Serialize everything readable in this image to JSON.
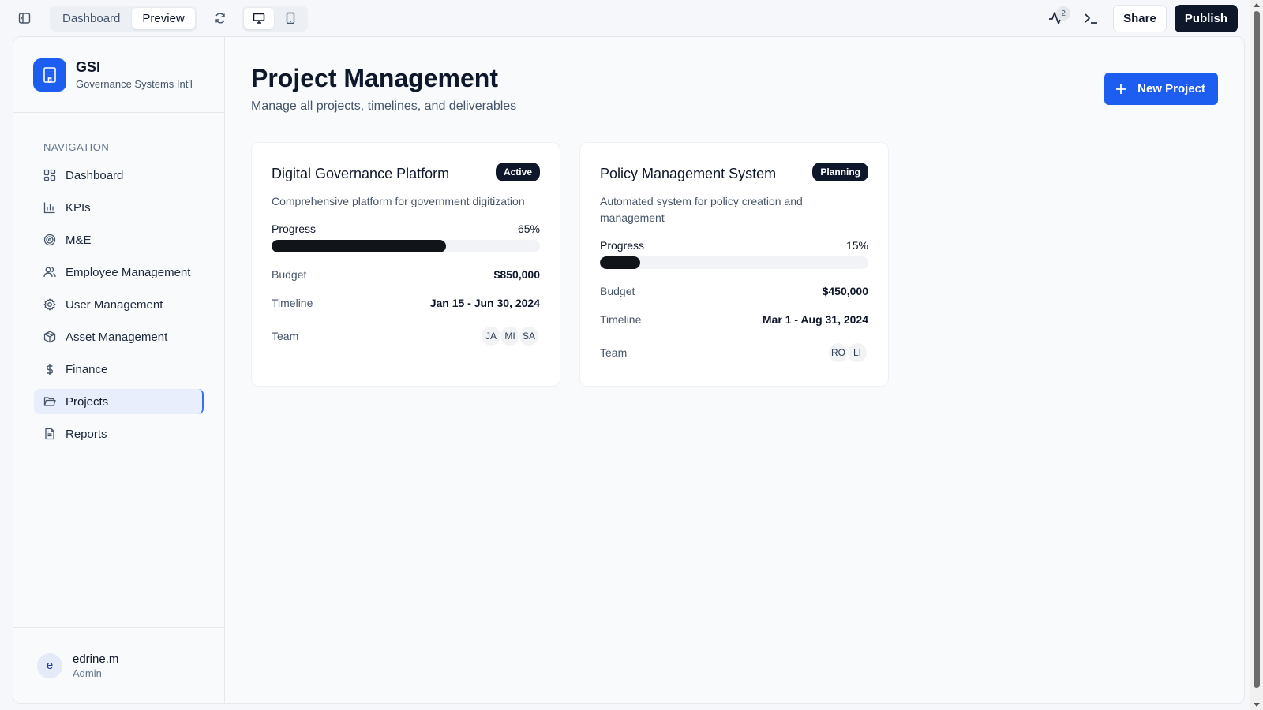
{
  "topbar": {
    "tabs": [
      {
        "label": "Dashboard",
        "active": false
      },
      {
        "label": "Preview",
        "active": true
      }
    ],
    "activity_count": "2",
    "share_label": "Share",
    "publish_label": "Publish"
  },
  "brand": {
    "name": "GSI",
    "subtitle": "Governance Systems Int'l",
    "color": "#1d5ef0"
  },
  "sidebar": {
    "heading": "NAVIGATION",
    "items": [
      {
        "label": "Dashboard",
        "icon": "grid-icon",
        "active": false
      },
      {
        "label": "KPIs",
        "icon": "bar-chart-icon",
        "active": false
      },
      {
        "label": "M&E",
        "icon": "target-icon",
        "active": false
      },
      {
        "label": "Employee Management",
        "icon": "users-icon",
        "active": false
      },
      {
        "label": "User Management",
        "icon": "gear-icon",
        "active": false
      },
      {
        "label": "Asset Management",
        "icon": "package-icon",
        "active": false
      },
      {
        "label": "Finance",
        "icon": "dollar-icon",
        "active": false
      },
      {
        "label": "Projects",
        "icon": "folder-icon",
        "active": true
      },
      {
        "label": "Reports",
        "icon": "file-icon",
        "active": false
      }
    ]
  },
  "user": {
    "initial": "e",
    "name": "edrine.m",
    "role": "Admin"
  },
  "main": {
    "title": "Project Management",
    "subtitle": "Manage all projects, timelines, and deliverables",
    "new_project_label": "New Project",
    "labels": {
      "progress": "Progress",
      "budget": "Budget",
      "timeline": "Timeline",
      "team": "Team"
    },
    "projects": [
      {
        "name": "Digital Governance Platform",
        "status": "Active",
        "description": "Comprehensive platform for government digitization",
        "progress": 65,
        "progress_label": "65%",
        "budget": "$850,000",
        "timeline": "Jan 15 - Jun 30, 2024",
        "team": [
          "JA",
          "MI",
          "SA"
        ]
      },
      {
        "name": "Policy Management System",
        "status": "Planning",
        "description": "Automated system for policy creation and management",
        "progress": 15,
        "progress_label": "15%",
        "budget": "$450,000",
        "timeline": "Mar 1 - Aug 31, 2024",
        "team": [
          "RO",
          "LI"
        ]
      }
    ]
  }
}
